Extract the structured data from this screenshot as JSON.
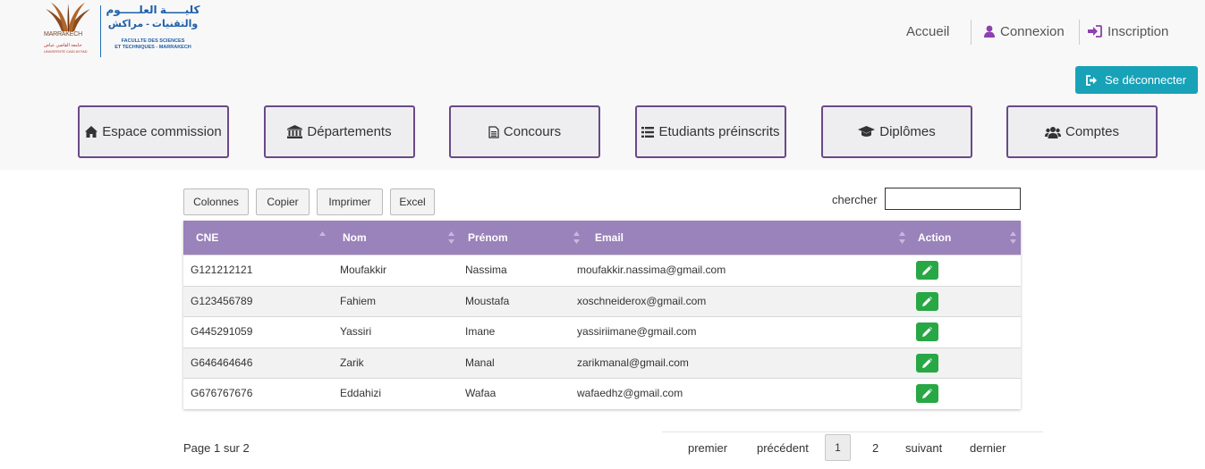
{
  "logo": {
    "city": "MARRAKECH",
    "university_ar": "جامعة القاضي عياض",
    "university_fr": "UNIVERSITE CADI AYYAD",
    "faculty_ar_line1": "كليـــــة العلـــــوم",
    "faculty_ar_line2": "والتقنيات - مراكش",
    "faculty_fr_line1": "FACULLTE DES SCIENCES",
    "faculty_fr_line2": "ET TECHNIQUES - MARRAKECH"
  },
  "topnav": {
    "home": "Accueil",
    "login": "Connexion",
    "signup": "Inscription"
  },
  "logout_label": "Se déconnecter",
  "tiles": [
    {
      "label": "Espace commission",
      "icon": "home-icon"
    },
    {
      "label": "Départements",
      "icon": "institution-icon"
    },
    {
      "label": "Concours",
      "icon": "document-icon"
    },
    {
      "label": "Etudiants préinscrits",
      "icon": "list-icon"
    },
    {
      "label": "Diplômes",
      "icon": "graduation-cap-icon"
    },
    {
      "label": "Comptes",
      "icon": "users-icon"
    }
  ],
  "toolbar": {
    "columns": "Colonnes",
    "copy": "Copier",
    "print": "Imprimer",
    "excel": "Excel",
    "search_label": "chercher",
    "search_value": ""
  },
  "table": {
    "headers": [
      "CNE",
      "Nom",
      "Prénom",
      "Email",
      "Action"
    ],
    "rows": [
      {
        "cne": "G121212121",
        "nom": "Moufakkir",
        "prenom": "Nassima",
        "email": "moufakkir.nassima@gmail.com"
      },
      {
        "cne": "G123456789",
        "nom": "Fahiem",
        "prenom": "Moustafa",
        "email": "xoschneiderox@gmail.com"
      },
      {
        "cne": "G445291059",
        "nom": "Yassiri",
        "prenom": "Imane",
        "email": "yassiriimane@gmail.com"
      },
      {
        "cne": "G646464646",
        "nom": "Zarik",
        "prenom": "Manal",
        "email": "zarikmanal@gmail.com"
      },
      {
        "cne": "G676767676",
        "nom": "Eddahizi",
        "prenom": "Wafaa",
        "email": "wafaedhz@gmail.com"
      }
    ]
  },
  "pagination": {
    "info": "Page 1 sur 2",
    "first": "premier",
    "previous": "précédent",
    "current": "1",
    "next_page": "2",
    "next": "suivant",
    "last": "dernier"
  },
  "colors": {
    "header_purple": "#9a82ba",
    "tile_border": "#6a4a86",
    "logout_teal": "#17a2b8",
    "edit_green": "#28a745",
    "brand_blue": "#1d5fa8"
  }
}
